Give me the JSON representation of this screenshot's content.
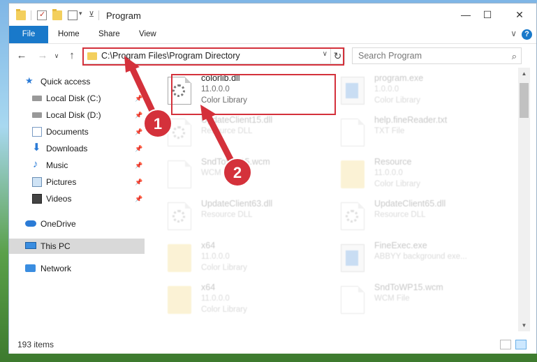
{
  "window": {
    "title": "Program",
    "controls": {
      "minimize": "—",
      "maximize": "☐",
      "close": "✕"
    }
  },
  "ribbon": {
    "tabs": [
      "File",
      "Home",
      "Share",
      "View"
    ],
    "expand_glyph": "∨",
    "help_glyph": "?"
  },
  "navigation": {
    "back": "←",
    "forward": "→",
    "recent": "∨",
    "up": "↑",
    "address": "C:\\Program Files\\Program Directory",
    "refresh": "↻",
    "search_placeholder": "Search Program"
  },
  "nav_pane": {
    "items": [
      {
        "label": "Quick access",
        "icon": "star-icon",
        "pinned": false
      },
      {
        "label": "Local Disk (C:)",
        "icon": "drive-icon",
        "pinned": true
      },
      {
        "label": "Local Disk (D:)",
        "icon": "drive-icon",
        "pinned": true
      },
      {
        "label": "Documents",
        "icon": "documents-icon",
        "pinned": true
      },
      {
        "label": "Downloads",
        "icon": "downloads-icon",
        "pinned": true
      },
      {
        "label": "Music",
        "icon": "music-icon",
        "pinned": true
      },
      {
        "label": "Pictures",
        "icon": "pictures-icon",
        "pinned": true
      },
      {
        "label": "Videos",
        "icon": "videos-icon",
        "pinned": true
      },
      {
        "label": "OneDrive",
        "icon": "cloud-icon",
        "pinned": false
      },
      {
        "label": "This PC",
        "icon": "computer-icon",
        "pinned": false,
        "selected": true
      },
      {
        "label": "Network",
        "icon": "network-icon",
        "pinned": false
      }
    ]
  },
  "files": [
    {
      "name": "colorlib.dll",
      "line2": "11.0.0.0",
      "line3": "Color Library",
      "icon": "gear-file-icon",
      "highlighted": true
    },
    {
      "name": "program.exe",
      "line2": "1.0.0.0",
      "line3": "Color Library",
      "icon": "exe-icon",
      "faded": true
    },
    {
      "name": "UpdateClient15.dll",
      "line2": "Resource DLL",
      "line3": "",
      "icon": "gear-file-icon",
      "faded": true
    },
    {
      "name": "help.fineReader.txt",
      "line2": "TXT File",
      "line3": "",
      "icon": "text-file-icon",
      "faded": true
    },
    {
      "name": "SndToWP15.wcm",
      "line2": "WCM File",
      "line3": "",
      "icon": "text-file-icon",
      "faded": true
    },
    {
      "name": "Resource",
      "line2": "11.0.0.0",
      "line3": "Color Library",
      "icon": "folder-icon",
      "faded": true
    },
    {
      "name": "UpdateClient63.dll",
      "line2": "Resource DLL",
      "line3": "",
      "icon": "gear-file-icon",
      "faded": true
    },
    {
      "name": "UpdateClient65.dll",
      "line2": "Resource DLL",
      "line3": "",
      "icon": "gear-file-icon",
      "faded": true
    },
    {
      "name": "x64",
      "line2": "11.0.0.0",
      "line3": "Color Library",
      "icon": "folder-icon",
      "faded": true
    },
    {
      "name": "FineExec.exe",
      "line2": "ABBYY background exe...",
      "line3": "",
      "icon": "exe-icon",
      "faded": true
    },
    {
      "name": "x64",
      "line2": "11.0.0.0",
      "line3": "Color Library",
      "icon": "folder-icon",
      "faded": true
    },
    {
      "name": "SndToWP15.wcm",
      "line2": "WCM File",
      "line3": "",
      "icon": "text-file-icon",
      "faded": true
    }
  ],
  "status": {
    "item_count": "193 items"
  },
  "annotations": {
    "step1": "1",
    "step2": "2"
  },
  "colors": {
    "accent": "#1979ca",
    "annotation": "#d4313b",
    "selected_nav": "#d9d9d9"
  }
}
